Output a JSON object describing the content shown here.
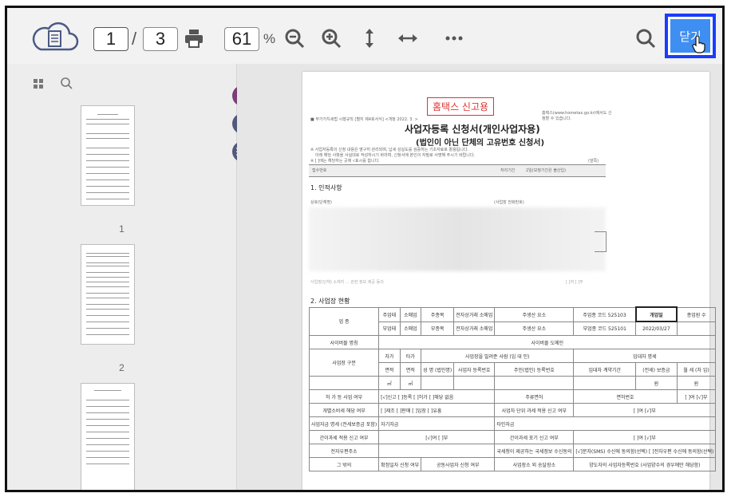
{
  "toolbar": {
    "current_page": "1",
    "separator": "/",
    "total_pages": "3",
    "zoom_value": "61",
    "zoom_unit": "%",
    "close_label": "닫기",
    "icons": [
      "cloud-document-icon",
      "print-icon",
      "zoom-out-icon",
      "zoom-in-icon",
      "fit-height-icon",
      "fit-width-icon",
      "more-icon",
      "search-icon"
    ]
  },
  "sidebar": {
    "icons": [
      "thumbnails-icon",
      "search-icon"
    ],
    "thumbnails": [
      {
        "label": "1"
      },
      {
        "label": "2"
      }
    ]
  },
  "document": {
    "stamp": "홈택스 신고용",
    "form_ref": "■ 부가가치세법 시행규칙 [별지 제4호서식] <개정 2022. 3. >",
    "note_right": "홈택스(www.hometax.go.kr)에서도 신청할 수 있습니다.",
    "title": "사업자등록 신청서(개인사업자용)",
    "subtitle": "(법인이 아닌 단체의 고유번호 신청서)",
    "line1": "※ 사업자등록의 신청 내용은 영구히 관리되며, 납세 성실도를 검증하는 기초자료로 활용됩니다.",
    "line2": "아래 해당 사항을 사실대로 작성하시기 바라며, 신청서에 본인이 자필로 서명해 주시기 바랍니다.",
    "line3": "※ [ ]에는 해당하는 곳에 √표시를 합니다.",
    "receipt_label": "접수번호",
    "processing_label": "처리기간",
    "processing_value": "2일(보정기간은 불산입)",
    "side_mark": "(앞쪽)",
    "section1": "1. 인적사항",
    "name_label": "상호(단체명)",
    "phone_label": "(사업장 전화번호)",
    "privacy_line": "사업장(단체) 소재지 ... 관련 정보 제공 동의",
    "yes_no": "[ ]여  [ ]부",
    "section2": "2. 사업장 현황",
    "industry_label": "업 종",
    "main_label": "주업태",
    "sub_label": "부업태",
    "item_label": "주종목",
    "subitem_label": "부종목",
    "wholesale": "소매업",
    "cat1": "전자상거래 소매업",
    "cat2": "주생산 요소",
    "code_label1": "주업종 코드",
    "code1": "525103",
    "code_label2": "부업종 코드",
    "code2": "525101",
    "open_date_label": "개업일",
    "open_date": "2022/03/27",
    "employees_label": "종업원 수",
    "cyber_mall": "사이버몰 명칭",
    "cyber_domain": "사이버몰 도메인",
    "place_type": "사업장 구분",
    "own": "자가",
    "rent": "타가",
    "rent_detail": "임대차 명세",
    "area": "면적",
    "person": "사업장을 빌려준 사람 (임 대 인)",
    "name_col": "성 명 (법인명)",
    "biz_no": "사업자 등록번호",
    "resident_no": "주민(법인) 등록번호",
    "period": "임대차 계약기간",
    "deposit": "(전세) 보증금",
    "monthly": "월 세 (차 임)",
    "m2": "㎡",
    "won": "원",
    "license": "허 가 등 사업 여부",
    "license_opts": "[√]신고 [ ]등록 [ ]허가 [ ]해당 없음",
    "license_no": "주류면허",
    "license_no_val": "면허번호",
    "license_apply": "면허신청",
    "yn": "[ ]여 [√]부",
    "tax_item": "개별소비세 해당 여부",
    "tax_opts": "[ ]제조 [ ]판매 [ ]입장 [ ]유흥",
    "unit_report": "사업자 단위 과세 적용 신고 여부",
    "unit_yn": "[ ]여 [√]부",
    "funds": "사업자금 명세 (전세보증금 포함)",
    "own_funds": "자기자금",
    "other_funds": "타인자금",
    "simple_tax": "간이과세 적용 신고 여부",
    "simple_yn": "[√]여 [ ]부",
    "simple_give": "간이과세 포기 신고 여부",
    "simple_give_yn": "[ ]여 [√]부",
    "email_label": "전자우편주소",
    "notice": "국세청이 제공하는 국세정보 수신동의",
    "notice_opts": "[√]문자(SMS) 수신에 동의함(선택) [ ]전자우편 수신에 동의함(선택)",
    "other": "그 밖의",
    "other1": "확정일자 신청 여부",
    "other2": "공동사업자 신청 여부",
    "other3": "사업장소 외 송달장소",
    "other4": "양도자의 사업자등록번호 (사업양수의 경우에만 해당함)"
  }
}
